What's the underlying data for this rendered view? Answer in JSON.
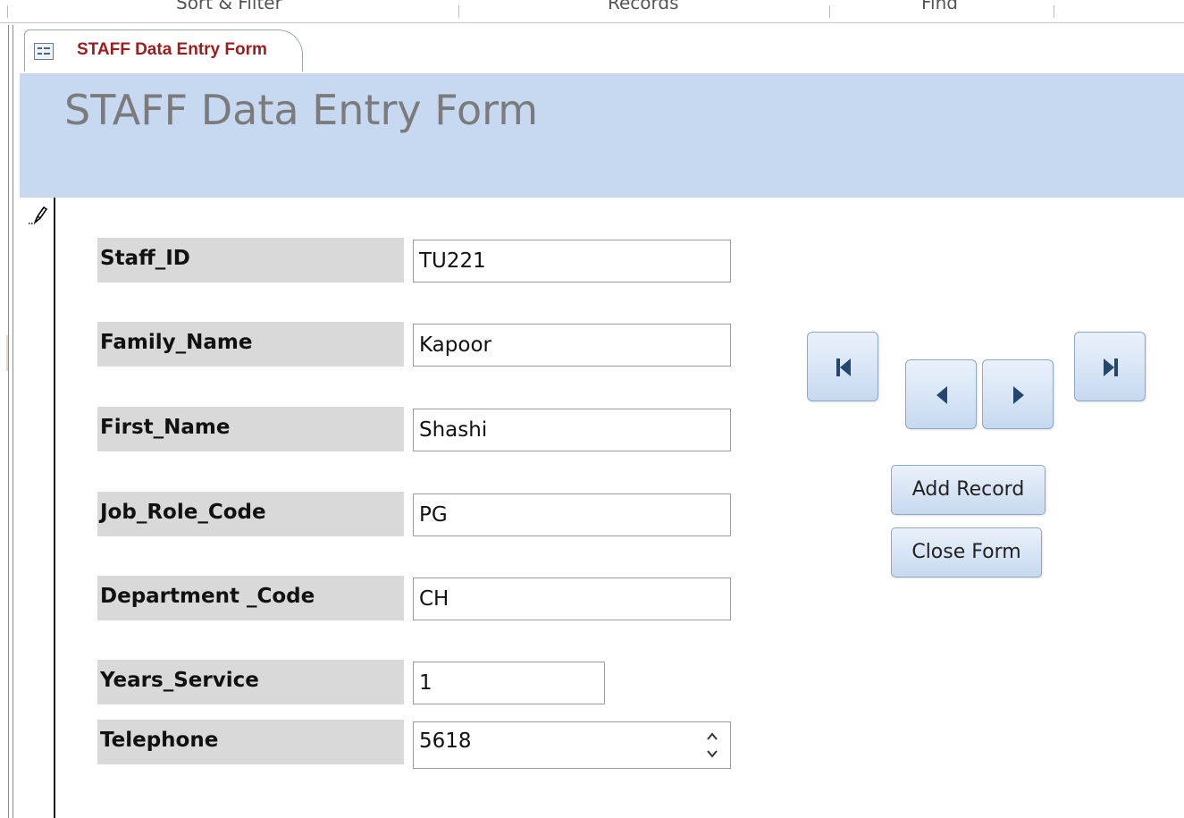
{
  "ribbon": {
    "groups": [
      "Sort & Filter",
      "Records",
      "Find"
    ]
  },
  "tab": {
    "title": "STAFF Data Entry Form",
    "icon": "form-icon"
  },
  "form": {
    "title": "STAFF Data Entry Form",
    "fields": [
      {
        "label": "Staff_ID",
        "value": "TU221"
      },
      {
        "label": "Family_Name",
        "value": "Kapoor"
      },
      {
        "label": "First_Name",
        "value": "Shashi"
      },
      {
        "label": "Job_Role_Code",
        "value": "PG"
      },
      {
        "label": "Department _Code",
        "value": "CH"
      },
      {
        "label": "Years_Service",
        "value": "1"
      },
      {
        "label": "Telephone",
        "value": "5618"
      }
    ]
  },
  "navigation": {
    "first_icon": "first-record-icon",
    "previous_icon": "previous-record-icon",
    "next_icon": "next-record-icon",
    "last_icon": "last-record-icon"
  },
  "buttons": {
    "add_record": "Add Record",
    "close_form": "Close Form"
  },
  "record_selector_icon": "pencil-icon",
  "colors": {
    "header_bg": "#c6d9f1",
    "label_bg": "#d9d9d9",
    "tab_title": "#9d1d1d",
    "icon_blue": "#25466e"
  }
}
